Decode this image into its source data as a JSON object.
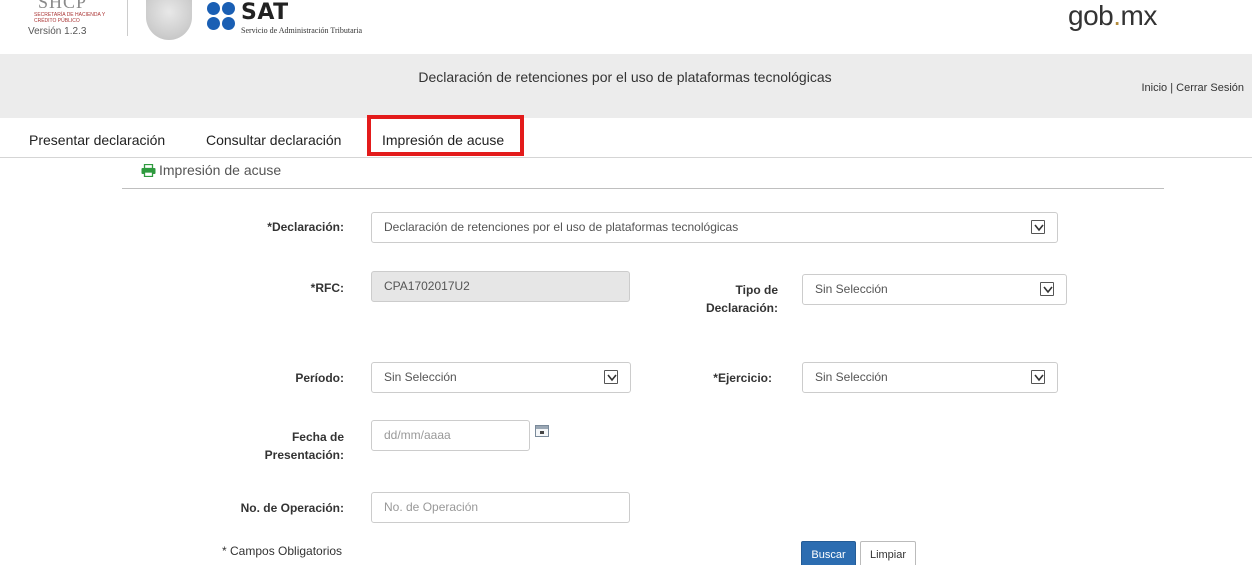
{
  "header": {
    "shcp_logo": "SHCP",
    "shcp_sub": "SECRETARÍA DE HACIENDA Y CRÉDITO PÚBLICO",
    "version": "Versión 1.2.3",
    "sat_word": "SAT",
    "sat_sub": "Servicio de Administración Tributaria",
    "gob_prefix": "gob",
    "gob_dot": ".",
    "gob_suffix": "mx"
  },
  "titlebar": {
    "title": "Declaración de retenciones por el uso de plataformas tecnológicas",
    "inicio": "Inicio",
    "separator": " | ",
    "cerrar": "Cerrar Sesión"
  },
  "tabs": [
    {
      "label": "Presentar declaración"
    },
    {
      "label": "Consultar declaración"
    },
    {
      "label": "Impresión de acuse",
      "active": true
    }
  ],
  "section": {
    "title": "Impresión de acuse",
    "icon": "printer-icon"
  },
  "form": {
    "declaracion": {
      "label": "*Declaración:",
      "value": "Declaración de retenciones por el uso de plataformas tecnológicas"
    },
    "rfc": {
      "label": "*RFC:",
      "value": "CPA1702017U2"
    },
    "tipo": {
      "label_line1": "Tipo de",
      "label_line2": "Declaración:",
      "value": "Sin Selección"
    },
    "periodo": {
      "label": "Período:",
      "value": "Sin Selección"
    },
    "ejercicio": {
      "label": "*Ejercicio:",
      "value": "Sin Selección"
    },
    "fecha": {
      "label_line1": "Fecha de",
      "label_line2": "Presentación:",
      "placeholder": "dd/mm/aaaa"
    },
    "operacion": {
      "label": "No. de Operación:",
      "placeholder": "No. de Operación"
    }
  },
  "note": "* Campos Obligatorios",
  "buttons": {
    "buscar": "Buscar",
    "limpiar": "Limpiar"
  },
  "colors": {
    "accent_red": "#e31b1b",
    "primary_blue": "#2c6db1",
    "printer_green": "#2e9a3e",
    "sat_blue": "#1a5fb4"
  }
}
